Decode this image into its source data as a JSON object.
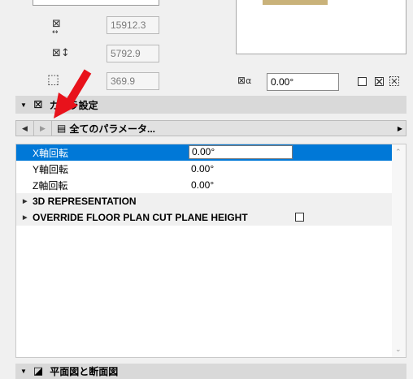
{
  "dimensions": {
    "width_value": "15912.3",
    "height_value": "5792.9",
    "depth_value": "369.9"
  },
  "angle": {
    "value": "0.00°"
  },
  "camera_section": {
    "title": "カメラ設定"
  },
  "nav": {
    "dropdown_label": "全てのパラメータ..."
  },
  "params": [
    {
      "label": "X軸回転",
      "value": "0.00°"
    },
    {
      "label": "Y軸回転",
      "value": "0.00°"
    },
    {
      "label": "Z軸回転",
      "value": "0.00°"
    }
  ],
  "groups": [
    {
      "label": "3D REPRESENTATION"
    },
    {
      "label": "OVERRIDE FLOOR PLAN CUT PLANE HEIGHT"
    }
  ],
  "bottom_section": {
    "title": "平面図と断面図"
  },
  "colors": {
    "selection": "#0078d7",
    "annotation_arrow": "#e8121b"
  }
}
